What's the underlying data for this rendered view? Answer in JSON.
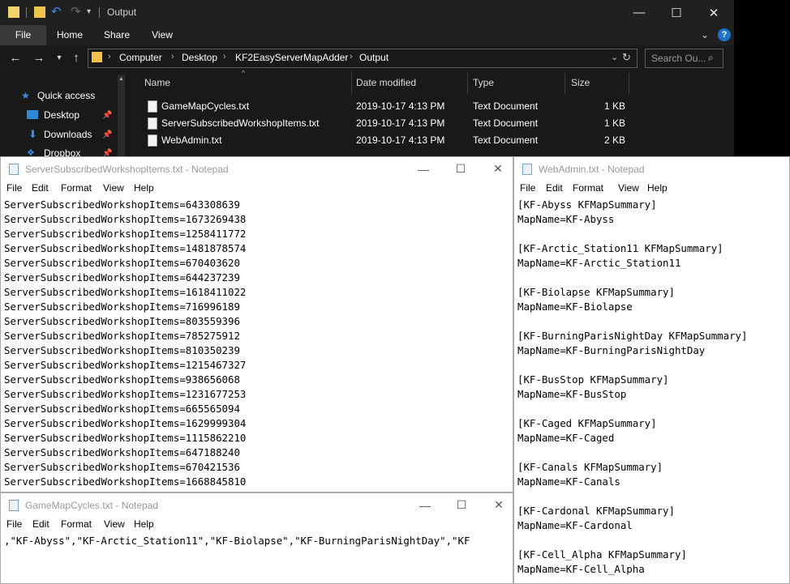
{
  "explorer": {
    "window_title": "Output",
    "ribbon_tabs": [
      "File",
      "Home",
      "Share",
      "View"
    ],
    "breadcrumbs": [
      "Computer",
      "Desktop",
      "KF2EasyServerMapAdder",
      "Output"
    ],
    "search_placeholder": "Search Ou...",
    "nav_items": [
      {
        "label": "Quick access",
        "icon": "star-icon"
      },
      {
        "label": "Desktop",
        "icon": "desktop-icon"
      },
      {
        "label": "Downloads",
        "icon": "download-icon"
      },
      {
        "label": "Dropbox",
        "icon": "dropbox-icon"
      }
    ],
    "columns": [
      "Name",
      "Date modified",
      "Type",
      "Size"
    ],
    "files": [
      {
        "name": "GameMapCycles.txt",
        "date": "2019-10-17 4:13 PM",
        "type": "Text Document",
        "size": "1 KB"
      },
      {
        "name": "ServerSubscribedWorkshopItems.txt",
        "date": "2019-10-17 4:13 PM",
        "type": "Text Document",
        "size": "1 KB"
      },
      {
        "name": "WebAdmin.txt",
        "date": "2019-10-17 4:13 PM",
        "type": "Text Document",
        "size": "2 KB"
      }
    ]
  },
  "notepad_workshop": {
    "title": "ServerSubscribedWorkshopItems.txt - Notepad",
    "menu": [
      "File",
      "Edit",
      "Format",
      "View",
      "Help"
    ],
    "lines": [
      "ServerSubscribedWorkshopItems=643308639",
      "ServerSubscribedWorkshopItems=1673269438",
      "ServerSubscribedWorkshopItems=1258411772",
      "ServerSubscribedWorkshopItems=1481878574",
      "ServerSubscribedWorkshopItems=670403620",
      "ServerSubscribedWorkshopItems=644237239",
      "ServerSubscribedWorkshopItems=1618411022",
      "ServerSubscribedWorkshopItems=716996189",
      "ServerSubscribedWorkshopItems=803559396",
      "ServerSubscribedWorkshopItems=785275912",
      "ServerSubscribedWorkshopItems=810350239",
      "ServerSubscribedWorkshopItems=1215467327",
      "ServerSubscribedWorkshopItems=938656068",
      "ServerSubscribedWorkshopItems=1231677253",
      "ServerSubscribedWorkshopItems=665565094",
      "ServerSubscribedWorkshopItems=1629999304",
      "ServerSubscribedWorkshopItems=1115862210",
      "ServerSubscribedWorkshopItems=647188240",
      "ServerSubscribedWorkshopItems=670421536",
      "ServerSubscribedWorkshopItems=1668845810"
    ]
  },
  "notepad_mapcycles": {
    "title": "GameMapCycles.txt - Notepad",
    "menu": [
      "File",
      "Edit",
      "Format",
      "View",
      "Help"
    ],
    "lines": [
      ",\"KF-Abyss\",\"KF-Arctic_Station11\",\"KF-Biolapse\",\"KF-BurningParisNightDay\",\"KF"
    ]
  },
  "notepad_webadmin": {
    "title": "WebAdmin.txt - Notepad",
    "menu": [
      "File",
      "Edit",
      "Format",
      "View",
      "Help"
    ],
    "lines": [
      "[KF-Abyss KFMapSummary]",
      "MapName=KF-Abyss",
      "",
      "[KF-Arctic_Station11 KFMapSummary]",
      "MapName=KF-Arctic_Station11",
      "",
      "[KF-Biolapse KFMapSummary]",
      "MapName=KF-Biolapse",
      "",
      "[KF-BurningParisNightDay KFMapSummary]",
      "MapName=KF-BurningParisNightDay",
      "",
      "[KF-BusStop KFMapSummary]",
      "MapName=KF-BusStop",
      "",
      "[KF-Caged KFMapSummary]",
      "MapName=KF-Caged",
      "",
      "[KF-Canals KFMapSummary]",
      "MapName=KF-Canals",
      "",
      "[KF-Cardonal KFMapSummary]",
      "MapName=KF-Cardonal",
      "",
      "[KF-Cell_Alpha KFMapSummary]",
      "MapName=KF-Cell_Alpha"
    ]
  }
}
